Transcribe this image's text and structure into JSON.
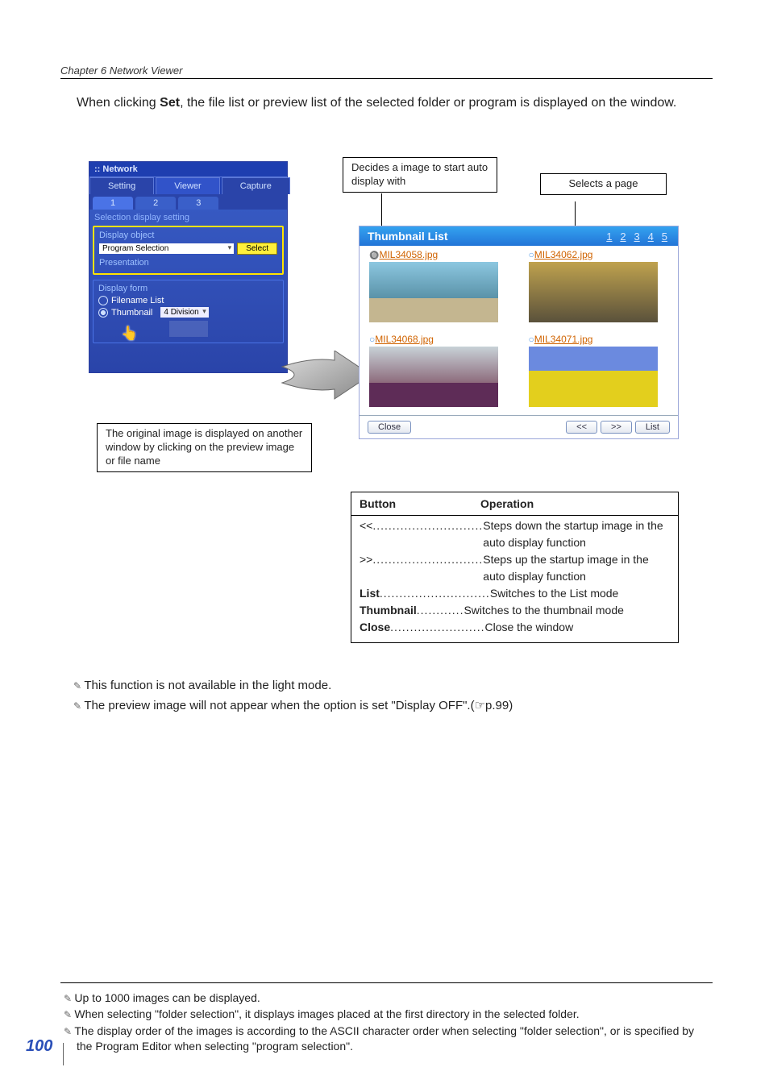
{
  "chapter": "Chapter 6 Network Viewer",
  "intro_pre": "When clicking ",
  "intro_bold": "Set",
  "intro_post": ", the file list or preview list of the selected folder or program is displayed on the window.",
  "panel": {
    "title": "Network",
    "tabs": {
      "setting": "Setting",
      "viewer": "Viewer",
      "capture": "Capture"
    },
    "subtabs": {
      "t1": "1",
      "t2": "2",
      "t3": "3"
    },
    "section": "Selection display setting",
    "display_object": "Display object",
    "program_selection": "Program Selection",
    "select": "Select",
    "presentation": "Presentation",
    "display_form": "Display form",
    "filename_list": "Filename List",
    "thumbnail": "Thumbnail",
    "four_division": "4 Division"
  },
  "callouts": {
    "c1": "Decides a image to start auto display with",
    "c2": "Selects a page",
    "c3": "The original image is displayed on another window by clicking on the preview image or file name"
  },
  "thumblist": {
    "title": "Thumbnail List",
    "pages": [
      "1",
      "2",
      "3",
      "4",
      "5"
    ],
    "files": {
      "f1": "MIL34058.jpg",
      "f2": "MIL34062.jpg",
      "f3": "MIL34068.jpg",
      "f4": "MIL34071.jpg"
    },
    "close": "Close",
    "prev": "<<",
    "next": ">>",
    "list": "List"
  },
  "optable": {
    "h1": "Button",
    "h2": "Operation",
    "rows": [
      {
        "k": "<<",
        "dots": "............................",
        "d": "Steps down the startup image in the auto display function"
      },
      {
        "k": ">>",
        "dots": "............................",
        "d": "Steps up the startup image in the auto display function"
      },
      {
        "k": "List",
        "bold": true,
        "dots": "............................",
        "d": "Switches to the List mode"
      },
      {
        "k": "Thumbnail",
        "bold": true,
        "dots": "............",
        "d": "Switches to the thumbnail mode"
      },
      {
        "k": "Close",
        "bold": true,
        "dots": "........................",
        "d": "Close the window"
      }
    ]
  },
  "notes": {
    "n1": "This function is not available in the light mode.",
    "n2": "The preview image will not appear when the option is set \"Display OFF\".(☞p.99)"
  },
  "footnotes": {
    "f1": "Up to 1000 images can be displayed.",
    "f2": "When selecting \"folder selection\", it displays images placed at the first directory in the selected folder.",
    "f3": "The display order of the images is according to the ASCII character order when selecting \"folder selection\", or is specified by the Program Editor when selecting \"program selection\"."
  },
  "pagenum": "100"
}
